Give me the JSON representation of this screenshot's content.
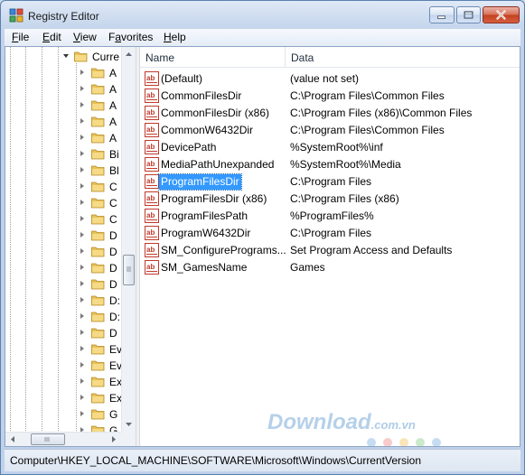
{
  "window": {
    "title": "Registry Editor"
  },
  "menu": [
    {
      "label": "File",
      "underline": "F",
      "rest": "ile"
    },
    {
      "label": "Edit",
      "underline": "E",
      "rest": "dit"
    },
    {
      "label": "View",
      "underline": "V",
      "rest": "iew"
    },
    {
      "label": "Favorites",
      "underline": "",
      "pre": "F",
      "underline_mid": "a",
      "rest": "vorites"
    },
    {
      "label": "Help",
      "underline": "H",
      "rest": "elp"
    }
  ],
  "tree": {
    "expanded_item": "Curre",
    "children": [
      "A",
      "A",
      "A",
      "A",
      "A",
      "Bi",
      "Bl",
      "C",
      "C",
      "C",
      "D",
      "D",
      "D",
      "D",
      "D:",
      "D:",
      "D",
      "Ev",
      "Ev",
      "Ex",
      "Ex",
      "G",
      "G"
    ]
  },
  "list": {
    "columns": {
      "name": "Name",
      "data": "Data"
    },
    "rows": [
      {
        "name": "(Default)",
        "data": "(value not set)",
        "selected": false
      },
      {
        "name": "CommonFilesDir",
        "data": "C:\\Program Files\\Common Files",
        "selected": false
      },
      {
        "name": "CommonFilesDir (x86)",
        "data": "C:\\Program Files (x86)\\Common Files",
        "selected": false
      },
      {
        "name": "CommonW6432Dir",
        "data": "C:\\Program Files\\Common Files",
        "selected": false
      },
      {
        "name": "DevicePath",
        "data": "%SystemRoot%\\inf",
        "selected": false
      },
      {
        "name": "MediaPathUnexpanded",
        "data": "%SystemRoot%\\Media",
        "selected": false
      },
      {
        "name": "ProgramFilesDir",
        "data": "C:\\Program Files",
        "selected": true
      },
      {
        "name": "ProgramFilesDir (x86)",
        "data": "C:\\Program Files (x86)",
        "selected": false
      },
      {
        "name": "ProgramFilesPath",
        "data": "%ProgramFiles%",
        "selected": false
      },
      {
        "name": "ProgramW6432Dir",
        "data": "C:\\Program Files",
        "selected": false
      },
      {
        "name": "SM_ConfigurePrograms...",
        "data": "Set Program Access and Defaults",
        "selected": false
      },
      {
        "name": "SM_GamesName",
        "data": "Games",
        "selected": false
      }
    ]
  },
  "status": {
    "path": "Computer\\HKEY_LOCAL_MACHINE\\SOFTWARE\\Microsoft\\Windows\\CurrentVersion"
  },
  "watermark": {
    "text": "Download",
    "suffix": ".com.vn"
  },
  "colors": {
    "selection": "#3399ff",
    "folder": "#e8c15a",
    "reg_icon_red": "#c0392b",
    "close_button": "#c2401f"
  }
}
